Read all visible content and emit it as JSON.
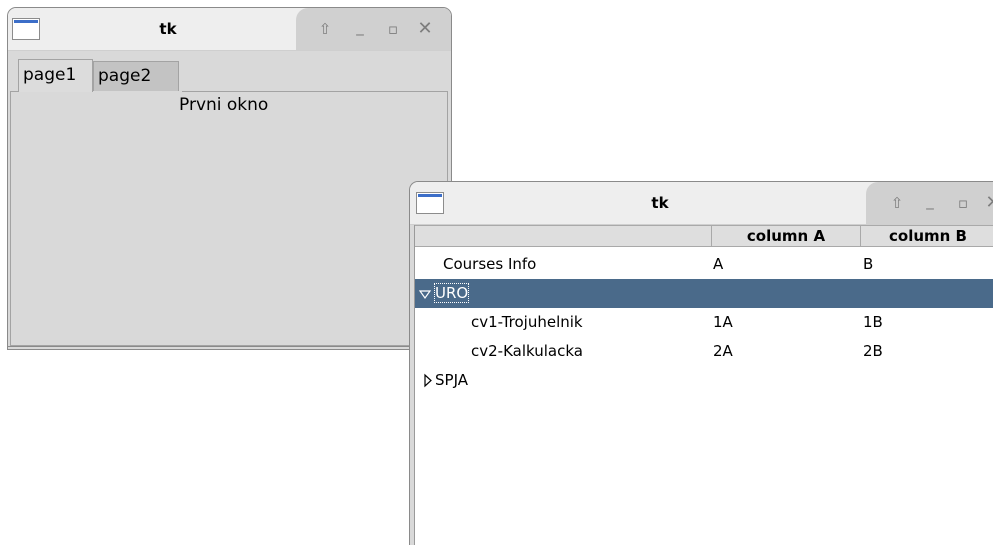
{
  "window1": {
    "title": "tk",
    "tabs": [
      {
        "label": "page1",
        "selected": true
      },
      {
        "label": "page2",
        "selected": false
      }
    ],
    "panel_text": "Prvni okno"
  },
  "window2": {
    "title": "tk",
    "columns": [
      "column A",
      "column B"
    ],
    "rows": [
      {
        "label": "Courses Info",
        "a": "A",
        "b": "B",
        "level": 0,
        "expander": "none",
        "selected": false
      },
      {
        "label": "URO",
        "a": "",
        "b": "",
        "level": 0,
        "expander": "expanded",
        "selected": true
      },
      {
        "label": "cv1-Trojuhelnik",
        "a": "1A",
        "b": "1B",
        "level": 1,
        "expander": "none",
        "selected": false
      },
      {
        "label": "cv2-Kalkulacka",
        "a": "2A",
        "b": "2B",
        "level": 1,
        "expander": "none",
        "selected": false
      },
      {
        "label": "SPJA",
        "a": "",
        "b": "",
        "level": 0,
        "expander": "collapsed",
        "selected": false
      }
    ]
  },
  "icons": {
    "window_buttons": [
      "shade-icon",
      "minimize-icon",
      "maximize-icon",
      "close-icon"
    ]
  },
  "colors": {
    "selection": "#4a6a8a",
    "window_bg": "#d9d9d9"
  }
}
